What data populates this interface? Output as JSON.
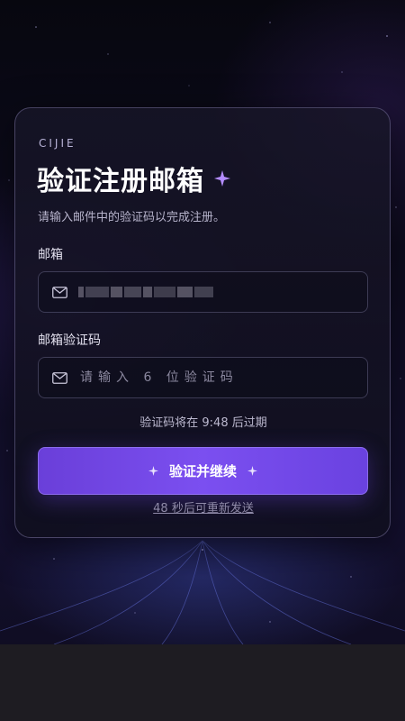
{
  "brand": "CIJIE",
  "title": "验证注册邮箱",
  "subtitle": "请输入邮件中的验证码以完成注册。",
  "email_field": {
    "label": "邮箱",
    "value_obscured": true
  },
  "code_field": {
    "label": "邮箱验证码",
    "placeholder": "请输入 6 位验证码",
    "value": ""
  },
  "expiry_text": "验证码将在 9:48 后过期",
  "verify_button_label": "验证并继续",
  "resend_text": "48 秒后可重新发送",
  "colors": {
    "accent": "#7b4ff0",
    "background": "#0e0c20",
    "card_border": "#aaa0dc"
  },
  "icons": {
    "title_sparkle": "sparkle-icon",
    "field_icon": "mail-icon"
  }
}
